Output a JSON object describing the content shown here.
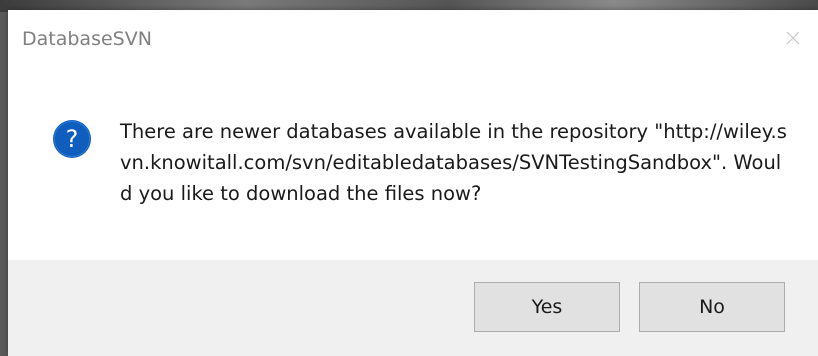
{
  "window": {
    "title": "DatabaseSVN"
  },
  "message": {
    "text": "There are newer databases available in the repository \"http://wiley.svn.knowitall.com/svn/editabledatabases/SVNTestingSandbox\". Would you like to download the files now?",
    "icon": "question-icon"
  },
  "buttons": {
    "yes_label": "Yes",
    "no_label": "No"
  },
  "colors": {
    "icon_blue": "#0f5dbd",
    "footer_bg": "#f0f0f0",
    "button_bg": "#e1e1e1",
    "button_border": "#adadad",
    "title_gray": "#808080"
  }
}
